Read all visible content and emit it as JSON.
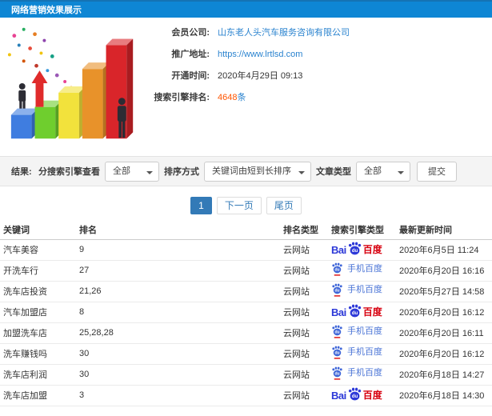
{
  "header": {
    "title": "网络营销效果展示"
  },
  "colors": {
    "header_bg": "#0e86d4",
    "link_blue": "#2a83cf",
    "rank_blue": "#4a90d2",
    "count_orange": "#ff5500",
    "pagination_active": "#337ab7",
    "baidu_blue": "#2d39d8",
    "baidu_red": "#d7000f",
    "mobile_blue": "#3f66d8",
    "mobile_underline_red": "#e02b2b"
  },
  "illustration": {
    "description": "3d-bar-chart-growth-clipart",
    "bar_colors": [
      "#3f7de0",
      "#6fce2e",
      "#f2e23c",
      "#e8922a",
      "#d9252a"
    ],
    "arrow_color": "#e02b2b",
    "figure_color": "#2c2c34"
  },
  "info": {
    "rows": [
      {
        "label": "会员公司:",
        "value": "山东老人头汽车服务咨询有限公司"
      },
      {
        "label": "推广地址:",
        "value": "https://www.lrtlsd.com"
      },
      {
        "label": "开通时间:",
        "value": "2020年4月29日 09:13"
      },
      {
        "label": "搜索引擎排名:",
        "count": "4648",
        "unit": "条"
      }
    ]
  },
  "filters": {
    "result_label": "结果:",
    "engine_label": "分搜索引擎查看",
    "engine_value": "全部",
    "sort_label": "排序方式",
    "sort_value": "关键词由短到长排序",
    "article_label": "文章类型",
    "article_value": "全部",
    "submit_label": "提交"
  },
  "pagination": {
    "current": "1",
    "next": "下一页",
    "last": "尾页"
  },
  "logos": {
    "baidu": {
      "bai": "Bai",
      "du": "du",
      "suffix": "百度"
    },
    "mobile": {
      "du": "du",
      "label": "手机百度"
    }
  },
  "table": {
    "headers": [
      "关键词",
      "排名",
      "排名类型",
      "搜索引擎类型",
      "最新更新时间"
    ],
    "rows": [
      {
        "keyword": "汽车美容",
        "rank": "9",
        "rank_type": "云网站",
        "engine": "百度",
        "time": "2020年6月5日 11:24"
      },
      {
        "keyword": "开洗车行",
        "rank": "27",
        "rank_type": "云网站",
        "engine": "手机百度",
        "time": "2020年6月20日 16:16"
      },
      {
        "keyword": "洗车店投资",
        "rank": "21,26",
        "rank_type": "云网站",
        "engine": "手机百度",
        "time": "2020年5月27日 14:58"
      },
      {
        "keyword": "汽车加盟店",
        "rank": "8",
        "rank_type": "云网站",
        "engine": "百度",
        "time": "2020年6月20日 16:12"
      },
      {
        "keyword": "加盟洗车店",
        "rank": "25,28,28",
        "rank_type": "云网站",
        "engine": "手机百度",
        "time": "2020年6月20日 16:11"
      },
      {
        "keyword": "洗车赚钱吗",
        "rank": "30",
        "rank_type": "云网站",
        "engine": "手机百度",
        "time": "2020年6月20日 16:12"
      },
      {
        "keyword": "洗车店利润",
        "rank": "30",
        "rank_type": "云网站",
        "engine": "手机百度",
        "time": "2020年6月18日 14:27"
      },
      {
        "keyword": "洗车店加盟",
        "rank": "3",
        "rank_type": "云网站",
        "engine": "百度",
        "time": "2020年6月18日 14:30"
      }
    ]
  }
}
